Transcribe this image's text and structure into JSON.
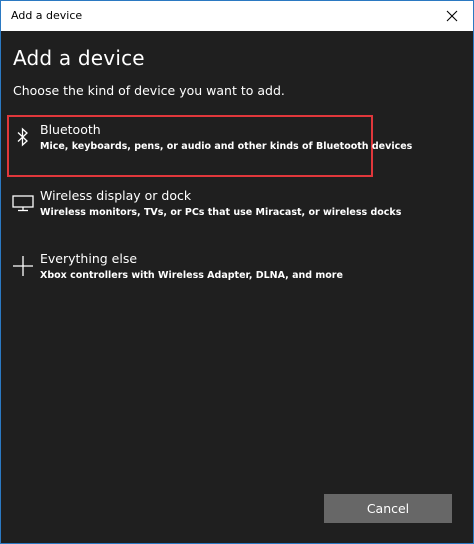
{
  "window": {
    "title": "Add a device"
  },
  "content": {
    "heading": "Add a device",
    "subheading": "Choose the kind of device you want to add."
  },
  "options": [
    {
      "icon": "bluetooth-icon",
      "label": "Bluetooth",
      "description": "Mice, keyboards, pens, or audio and other kinds of Bluetooth devices",
      "selected": true
    },
    {
      "icon": "monitor-icon",
      "label": "Wireless display or dock",
      "description": "Wireless monitors, TVs, or PCs that use Miracast, or wireless docks",
      "selected": false
    },
    {
      "icon": "plus-icon",
      "label": "Everything else",
      "description": "Xbox controllers with Wireless Adapter, DLNA, and more",
      "selected": false
    }
  ],
  "footer": {
    "cancel_label": "Cancel"
  },
  "colors": {
    "background": "#1f1f1f",
    "selection_border": "#e0373b",
    "button": "#676767",
    "window_border": "#2b79c2"
  }
}
